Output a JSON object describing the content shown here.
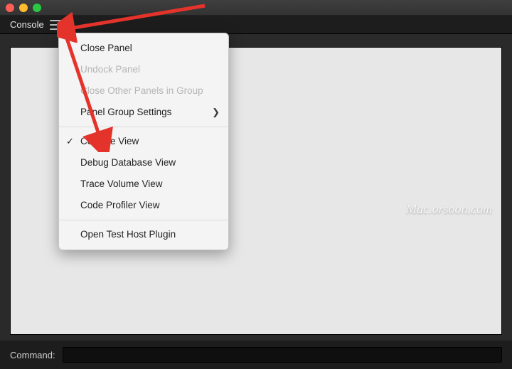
{
  "panel": {
    "title": "Console"
  },
  "menu": {
    "items": [
      {
        "label": "Close Panel",
        "disabled": false,
        "submenu": false,
        "checked": false
      },
      {
        "label": "Undock Panel",
        "disabled": true,
        "submenu": false,
        "checked": false
      },
      {
        "label": "Close Other Panels in Group",
        "disabled": true,
        "submenu": false,
        "checked": false
      },
      {
        "label": "Panel Group Settings",
        "disabled": false,
        "submenu": true,
        "checked": false
      }
    ],
    "views": [
      {
        "label": "Console View",
        "checked": true
      },
      {
        "label": "Debug Database View",
        "checked": false
      },
      {
        "label": "Trace Volume View",
        "checked": false
      },
      {
        "label": "Code Profiler View",
        "checked": false
      }
    ],
    "extra": [
      {
        "label": "Open Test Host Plugin"
      }
    ]
  },
  "command": {
    "label": "Command:",
    "value": ""
  },
  "watermark": "Mac.orsoon.com"
}
